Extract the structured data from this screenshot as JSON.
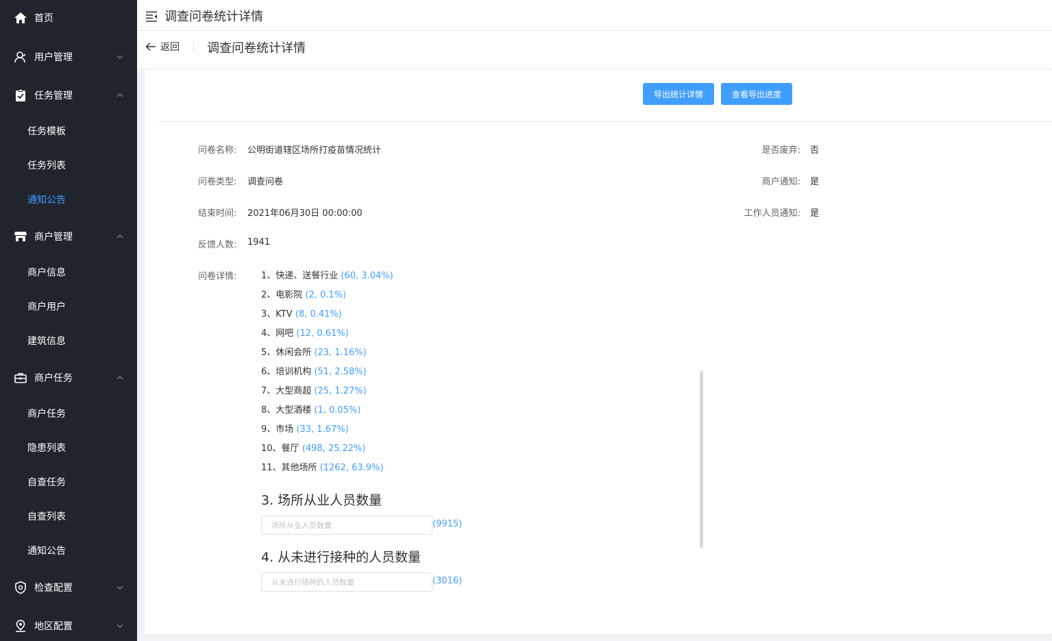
{
  "sidebar": {
    "home": "首页",
    "user_mgmt": "用户管理",
    "task_mgmt": "任务管理",
    "task_template": "任务模板",
    "task_list": "任务列表",
    "notice": "通知公告",
    "merchant_mgmt": "商户管理",
    "merchant_info": "商户信息",
    "merchant_user": "商户用户",
    "building_info": "建筑信息",
    "merchant_task_group": "商户任务",
    "merchant_task": "商户任务",
    "hazard_list": "隐患列表",
    "self_check_task": "自查任务",
    "self_check_list": "自查列表",
    "notice2": "通知公告",
    "inspection_config": "检查配置",
    "region_config": "地区配置"
  },
  "topbar": {
    "title": "调查问卷统计详情"
  },
  "page_header": {
    "back": "返回",
    "title": "调查问卷统计详情"
  },
  "actions": {
    "export": "导出统计详情",
    "progress": "查看导出进度"
  },
  "info": {
    "name_label": "问卷名称:",
    "name_value": "公明街道辖区场所打疫苗情况统计",
    "type_label": "问卷类型:",
    "type_value": "调查问卷",
    "end_label": "结束时间:",
    "end_value": "2021年06月30日 00:00:00",
    "feedback_label": "反馈人数:",
    "feedback_value": "1941",
    "discard_label": "是否废弃:",
    "discard_value": "否",
    "merchant_notify_label": "商户通知:",
    "merchant_notify_value": "是",
    "staff_notify_label": "工作人员通知:",
    "staff_notify_value": "是",
    "details_label": "问卷详情:"
  },
  "options": [
    {
      "text": "1、快递、送餐行业",
      "stat": "(60, 3.04%)"
    },
    {
      "text": "2、电影院",
      "stat": "(2, 0.1%)"
    },
    {
      "text": "3、KTV",
      "stat": "(8, 0.41%)"
    },
    {
      "text": "4、网吧",
      "stat": "(12, 0.61%)"
    },
    {
      "text": "5、休闲会所",
      "stat": "(23, 1.16%)"
    },
    {
      "text": "6、培训机构",
      "stat": "(51, 2.58%)"
    },
    {
      "text": "7、大型商超",
      "stat": "(25, 1.27%)"
    },
    {
      "text": "8、大型酒楼",
      "stat": "(1, 0.05%)"
    },
    {
      "text": "9、市场",
      "stat": "(33, 1.67%)"
    },
    {
      "text": "10、餐厅",
      "stat": "(498, 25.22%)"
    },
    {
      "text": "11、其他场所",
      "stat": "(1262, 63.9%)"
    }
  ],
  "q3": {
    "title": "3. 场所从业人员数量",
    "placeholder": "场所从业人员数量",
    "count": "(9915)"
  },
  "q4": {
    "title": "4. 从未进行接种的人员数量",
    "placeholder": "从未进行接种的人员数量",
    "count": "(3016)"
  }
}
